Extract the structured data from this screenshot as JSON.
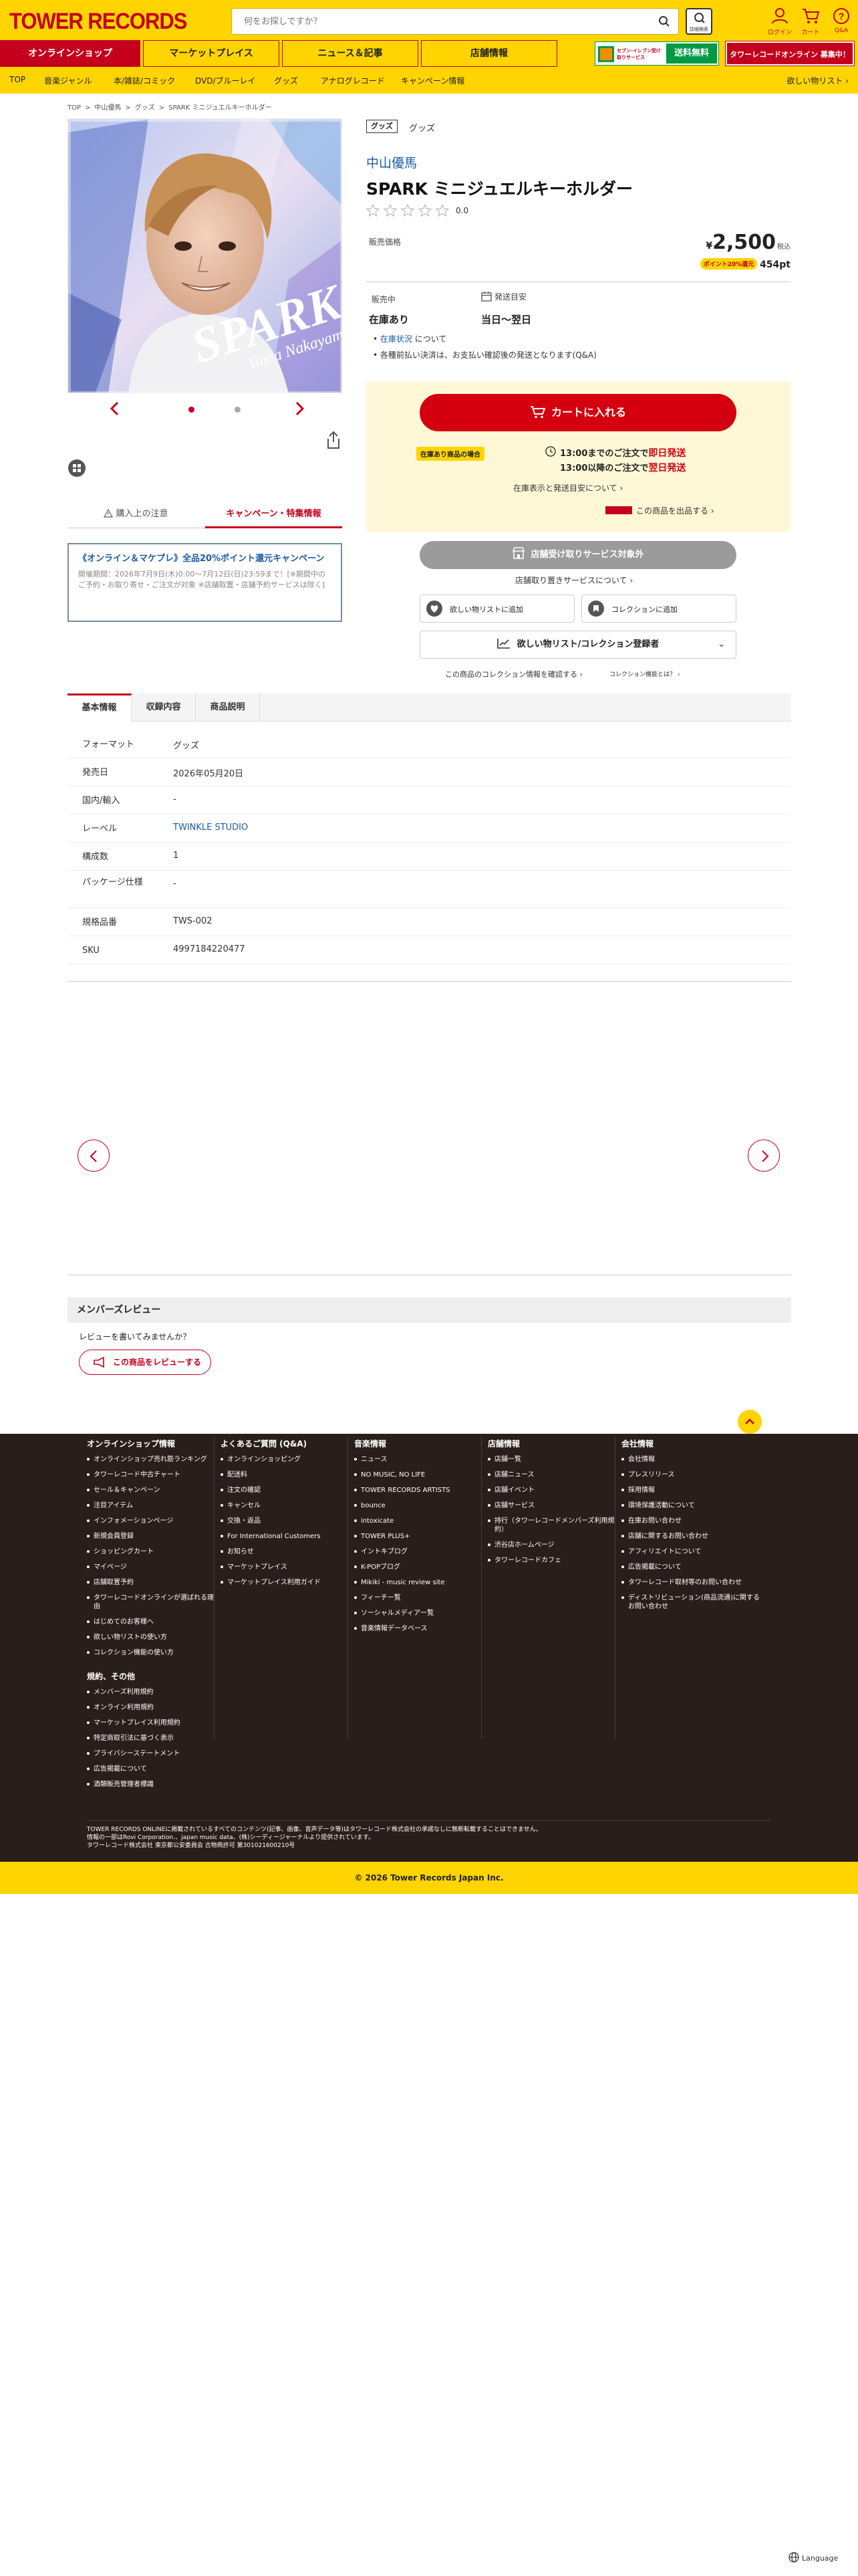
{
  "header": {
    "logo": "TOWER RECORDS",
    "search_placeholder": "何をお探しですか？",
    "detail_search": "詳細検索",
    "icons": [
      {
        "icon": "user-icon",
        "label": "ログイン"
      },
      {
        "icon": "cart-icon",
        "label": "カート"
      },
      {
        "icon": "help-icon",
        "label": "Q&A"
      }
    ],
    "tabs": [
      "オンラインショップ",
      "マーケットプレイス",
      "ニュース＆記事",
      "店舗情報"
    ],
    "banner1": "送料無料",
    "banner1_small": "セブン-イレブン受け取りサービス",
    "banner2": "タワーレコードオンライン 募集中！"
  },
  "nav": {
    "items": [
      "TOP",
      "音楽ジャンル",
      "本/雑誌/コミック",
      "DVD/ブルーレイ",
      "グッズ",
      "アナログレコード",
      "キャンペーン情報"
    ],
    "wishlist": "欲しい物リスト"
  },
  "breadcrumbs": [
    "TOP",
    "中山優馬",
    "グッズ",
    "SPARK ミニジュエルキーホルダー"
  ],
  "image_text": {
    "title": "SPARK",
    "artist": "Yuma Nakayama"
  },
  "left_tabs": {
    "notice": "購入上の注意",
    "campaign": "キャンペーン・特集情報"
  },
  "campaign": {
    "title": "《オンライン＆マケプレ》全品20%ポイント還元キャンペーン",
    "desc": "開催期間：2026年7月9日(木)0:00〜7月12日(日)23:59まで！[※期間中のご予約・お取り寄せ・ご注文が対象 ※店舗取置・店舗予約サービスは除く]"
  },
  "product": {
    "category_tag": "グッズ",
    "category": "グッズ",
    "artist": "中山優馬",
    "title": "SPARK ミニジュエルキーホルダー",
    "rating": "0.0",
    "price_label": "販売価格",
    "currency": "¥",
    "price": "2,500",
    "tax": "税込",
    "point_badge": "ポイント20%還元",
    "points": "454pt",
    "stock_label": "販売中",
    "ship_label": "発送目安",
    "stock_value": "在庫あり",
    "ship_value": "当日〜翌日",
    "note1_link": "在庫状況",
    "note1": "について",
    "note2": "各種前払い決済は、お支払い確認後の発送となります(Q&A)"
  },
  "cart": {
    "button": "カートに入れる",
    "badge": "在庫あり商品の場合",
    "line1a": "13:00までのご注文で",
    "line1b": "即日発送",
    "line2a": "13:00以降のご注文で",
    "line2b": "翌日発送",
    "stock_link": "在庫表示と発送目安について",
    "sell_link": "この商品を出品する"
  },
  "store": {
    "button": "店舗受け取りサービス対象外",
    "link": "店舗取り置きサービスについて",
    "wish": "欲しい物リストに追加",
    "collection": "コレクションに追加",
    "ranking": "欲しい物リスト/コレクション登録者",
    "check": "この商品のコレクション情報を確認する",
    "what": "コレクション機能とは？"
  },
  "info_tabs": [
    "基本情報",
    "収録内容",
    "商品説明"
  ],
  "spec": [
    {
      "k": "フォーマット",
      "v": "グッズ"
    },
    {
      "k": "発売日",
      "v": "2026年05月20日"
    },
    {
      "k": "国内/輸入",
      "v": "-"
    },
    {
      "k": "レーベル",
      "v": "TWINKLE STUDIO"
    },
    {
      "k": "構成数",
      "v": "1"
    },
    {
      "k": "パッケージ仕様",
      "v": "-"
    },
    {
      "k": "規格品番",
      "v": "TWS-002"
    },
    {
      "k": "SKU",
      "v": "4997184220477"
    }
  ],
  "review": {
    "heading": "メンバーズレビュー",
    "prompt": "レビューを書いてみませんか？",
    "button": "この商品をレビューする"
  },
  "footer": {
    "col1": {
      "title": "オンラインショップ情報",
      "items": [
        "オンラインショップ売れ筋ランキング",
        "タワーレコード中古チャート",
        "セール＆キャンペーン",
        "注目アイテム",
        "インフォメーションページ",
        "新規会員登録",
        "ショッピングカート",
        "マイページ",
        "店舗取置予約",
        "タワーレコードオンラインが選ばれる理由",
        "はじめてのお客様へ",
        "欲しい物リストの使い方",
        "コレクション機能の使い方"
      ]
    },
    "col1b": {
      "title": "規約、その他",
      "items": [
        "メンバーズ利用規約",
        "オンライン利用規約",
        "マーケットプレイス利用規約",
        "特定商取引法に基づく表示",
        "プライバシーステートメント",
        "広告掲載について",
        "酒類販売管理者標識"
      ]
    },
    "col2": {
      "title": "よくあるご質問 (Q&A)",
      "items": [
        "オンラインショッピング",
        "配送料",
        "注文の確認",
        "キャンセル",
        "交換・返品",
        "For International Customers",
        "お知らせ",
        "マーケットプレイス",
        "マーケットプレイス利用ガイド"
      ]
    },
    "col3": {
      "title": "音楽情報",
      "items": [
        "ニュース",
        "NO MUSIC, NO LIFE",
        "TOWER RECORDS ARTISTS",
        "bounce",
        "intoxicate",
        "TOWER PLUS+",
        "イントキブログ",
        "K-POPブログ",
        "Mikiki - music review site",
        "フィーチー覧",
        "ソーシャルメディア一覧",
        "音楽情報データベース"
      ]
    },
    "col4": {
      "title": "店舗情報",
      "items": [
        "店舗一覧",
        "店舗ニュース",
        "店舗イベント",
        "店舗サービス",
        "持行（タワーレコードメンバーズ利用規約）",
        "渋谷店ホームページ",
        "タワーレコードカフェ"
      ]
    },
    "col5": {
      "title": "会社情報",
      "items": [
        "会社情報",
        "プレスリリース",
        "採用情報",
        "環境保護活動について",
        "在庫お問い合わせ",
        "店舗に関するお問い合わせ",
        "アフィリエイトについて",
        "広告掲載について",
        "タワーレコード取材等のお問い合わせ",
        "ディストリビューション(商品流通)に関するお問い合わせ"
      ]
    },
    "legal": "TOWER RECORDS ONLINEに掲載されているすべてのコンテンツ(記事、画像、音声データ等)はタワーレコード株式会社の承諾なしに無断転載することはできません。",
    "legal2": "情報の一部はRovi Corporation.、japan music data、(株)シーディージャーナルより提供されています。",
    "legal3": "タワーレコード株式会社 東京都公安委員会 古物商許可 第301021600210号",
    "copyright": "© 2026 Tower Records Japan Inc.",
    "language": "Language"
  },
  "colors": {
    "brand_yellow": "#ffd400",
    "brand_red": "#c4001d",
    "footer_bg": "#2a1e1b"
  }
}
